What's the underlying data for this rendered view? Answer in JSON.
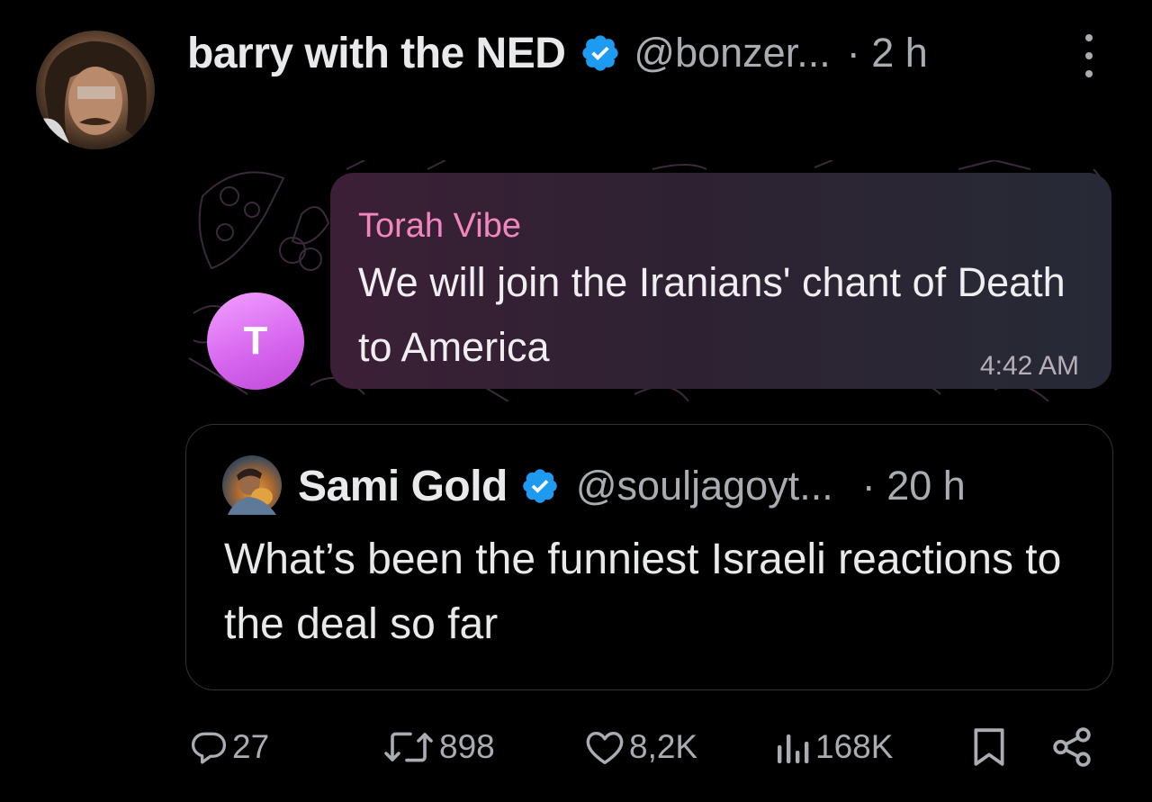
{
  "tweet": {
    "author_name": "barry with the NED",
    "author_handle": "@bonzer...",
    "time": "· 2 h",
    "avatar_icon": "profile-photo",
    "verified_color": "#1d9bf0"
  },
  "media": {
    "chat_avatar_letter": "T",
    "sender": "Torah Vibe",
    "message": "We will join the Iranians' chant of Death to America",
    "message_time": "4:42 AM",
    "sender_color": "#f287c0",
    "avatar_color": "#d564ee"
  },
  "quoted": {
    "author_name": "Sami Gold",
    "author_handle": "@souljagoyt...",
    "time": "· 20 h",
    "text": "What’s been the funniest Israeli reactions to the deal so far"
  },
  "actions": {
    "replies": "27",
    "retweets": "898",
    "likes": "8,2K",
    "views": "168K",
    "icons": [
      "reply-icon",
      "retweet-icon",
      "like-icon",
      "views-icon",
      "bookmark-icon",
      "share-icon"
    ]
  }
}
